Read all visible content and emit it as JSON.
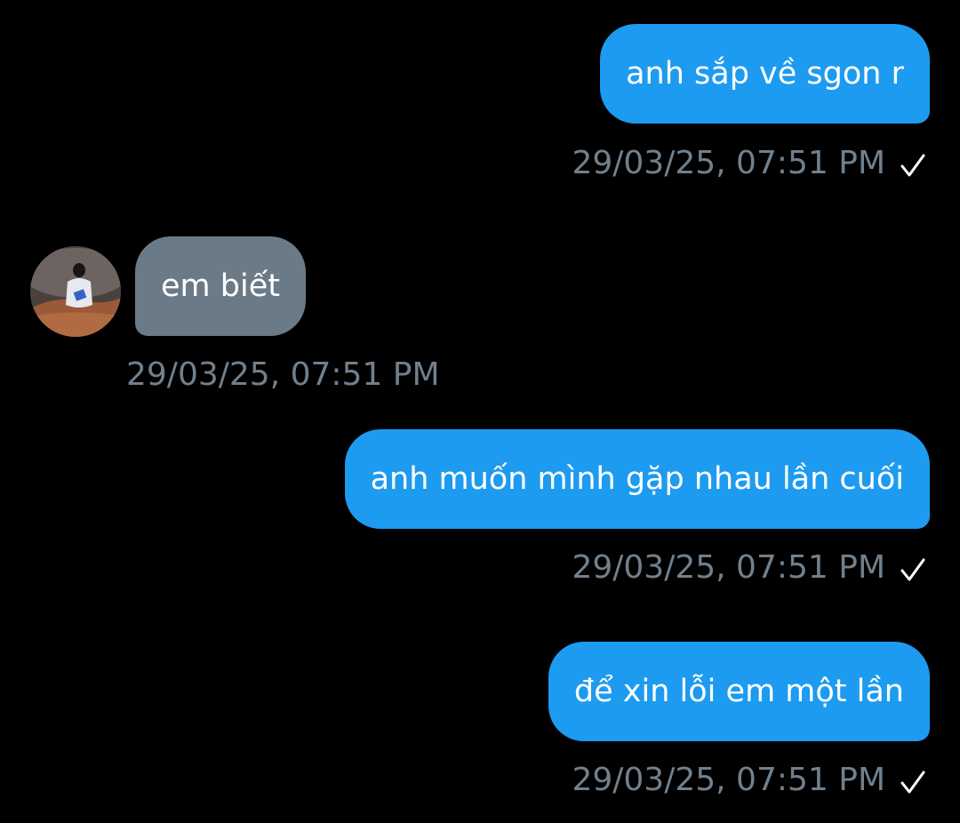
{
  "conversation": {
    "messages": [
      {
        "direction": "outgoing",
        "text": "anh sắp về sgon r",
        "timestamp": "29/03/25, 07:51 PM",
        "status_icon": "check-icon"
      },
      {
        "direction": "incoming",
        "text": "em biết",
        "timestamp": "29/03/25, 07:51 PM",
        "avatar_icon": "profile-photo"
      },
      {
        "direction": "outgoing",
        "text": "anh muốn mình gặp nhau lần cuối",
        "timestamp": "29/03/25, 07:51 PM",
        "status_icon": "check-icon"
      },
      {
        "direction": "outgoing",
        "text": "để xin lỗi em một lần",
        "timestamp": "29/03/25, 07:51 PM",
        "status_icon": "check-icon"
      }
    ]
  },
  "colors": {
    "background": "#000000",
    "outgoing_bubble": "#1d9bf0",
    "incoming_bubble": "#6b7a87",
    "timestamp_text": "#71808d",
    "message_text": "#ffffff"
  }
}
